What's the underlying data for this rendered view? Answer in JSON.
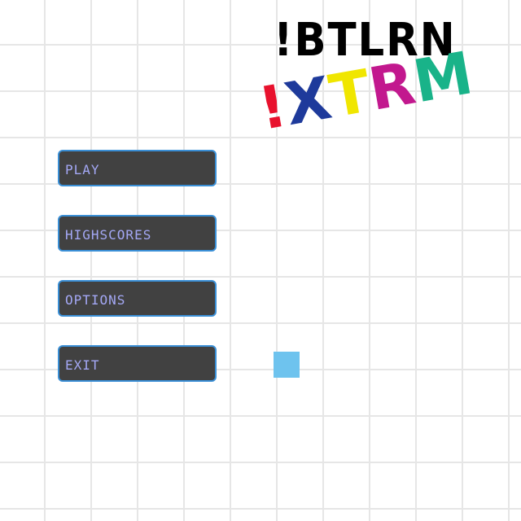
{
  "title": {
    "main": "!BTLRN",
    "sub_letters": [
      {
        "char": "!",
        "color": "#e8112d"
      },
      {
        "char": "X",
        "color": "#1e3a9b"
      },
      {
        "char": "T",
        "color": "#f0e600"
      },
      {
        "char": "R",
        "color": "#c2188e"
      },
      {
        "char": "M",
        "color": "#19b389"
      }
    ]
  },
  "menu": {
    "items": [
      {
        "label": "PLAY"
      },
      {
        "label": "HIGHSCORES"
      },
      {
        "label": "OPTIONS"
      },
      {
        "label": "EXIT"
      }
    ]
  },
  "colors": {
    "button_bg": "#414141",
    "button_border": "#3a8fd6",
    "button_text": "#a4a8f5",
    "player": "#6ec3ee",
    "grid": "#e6e6e6"
  }
}
